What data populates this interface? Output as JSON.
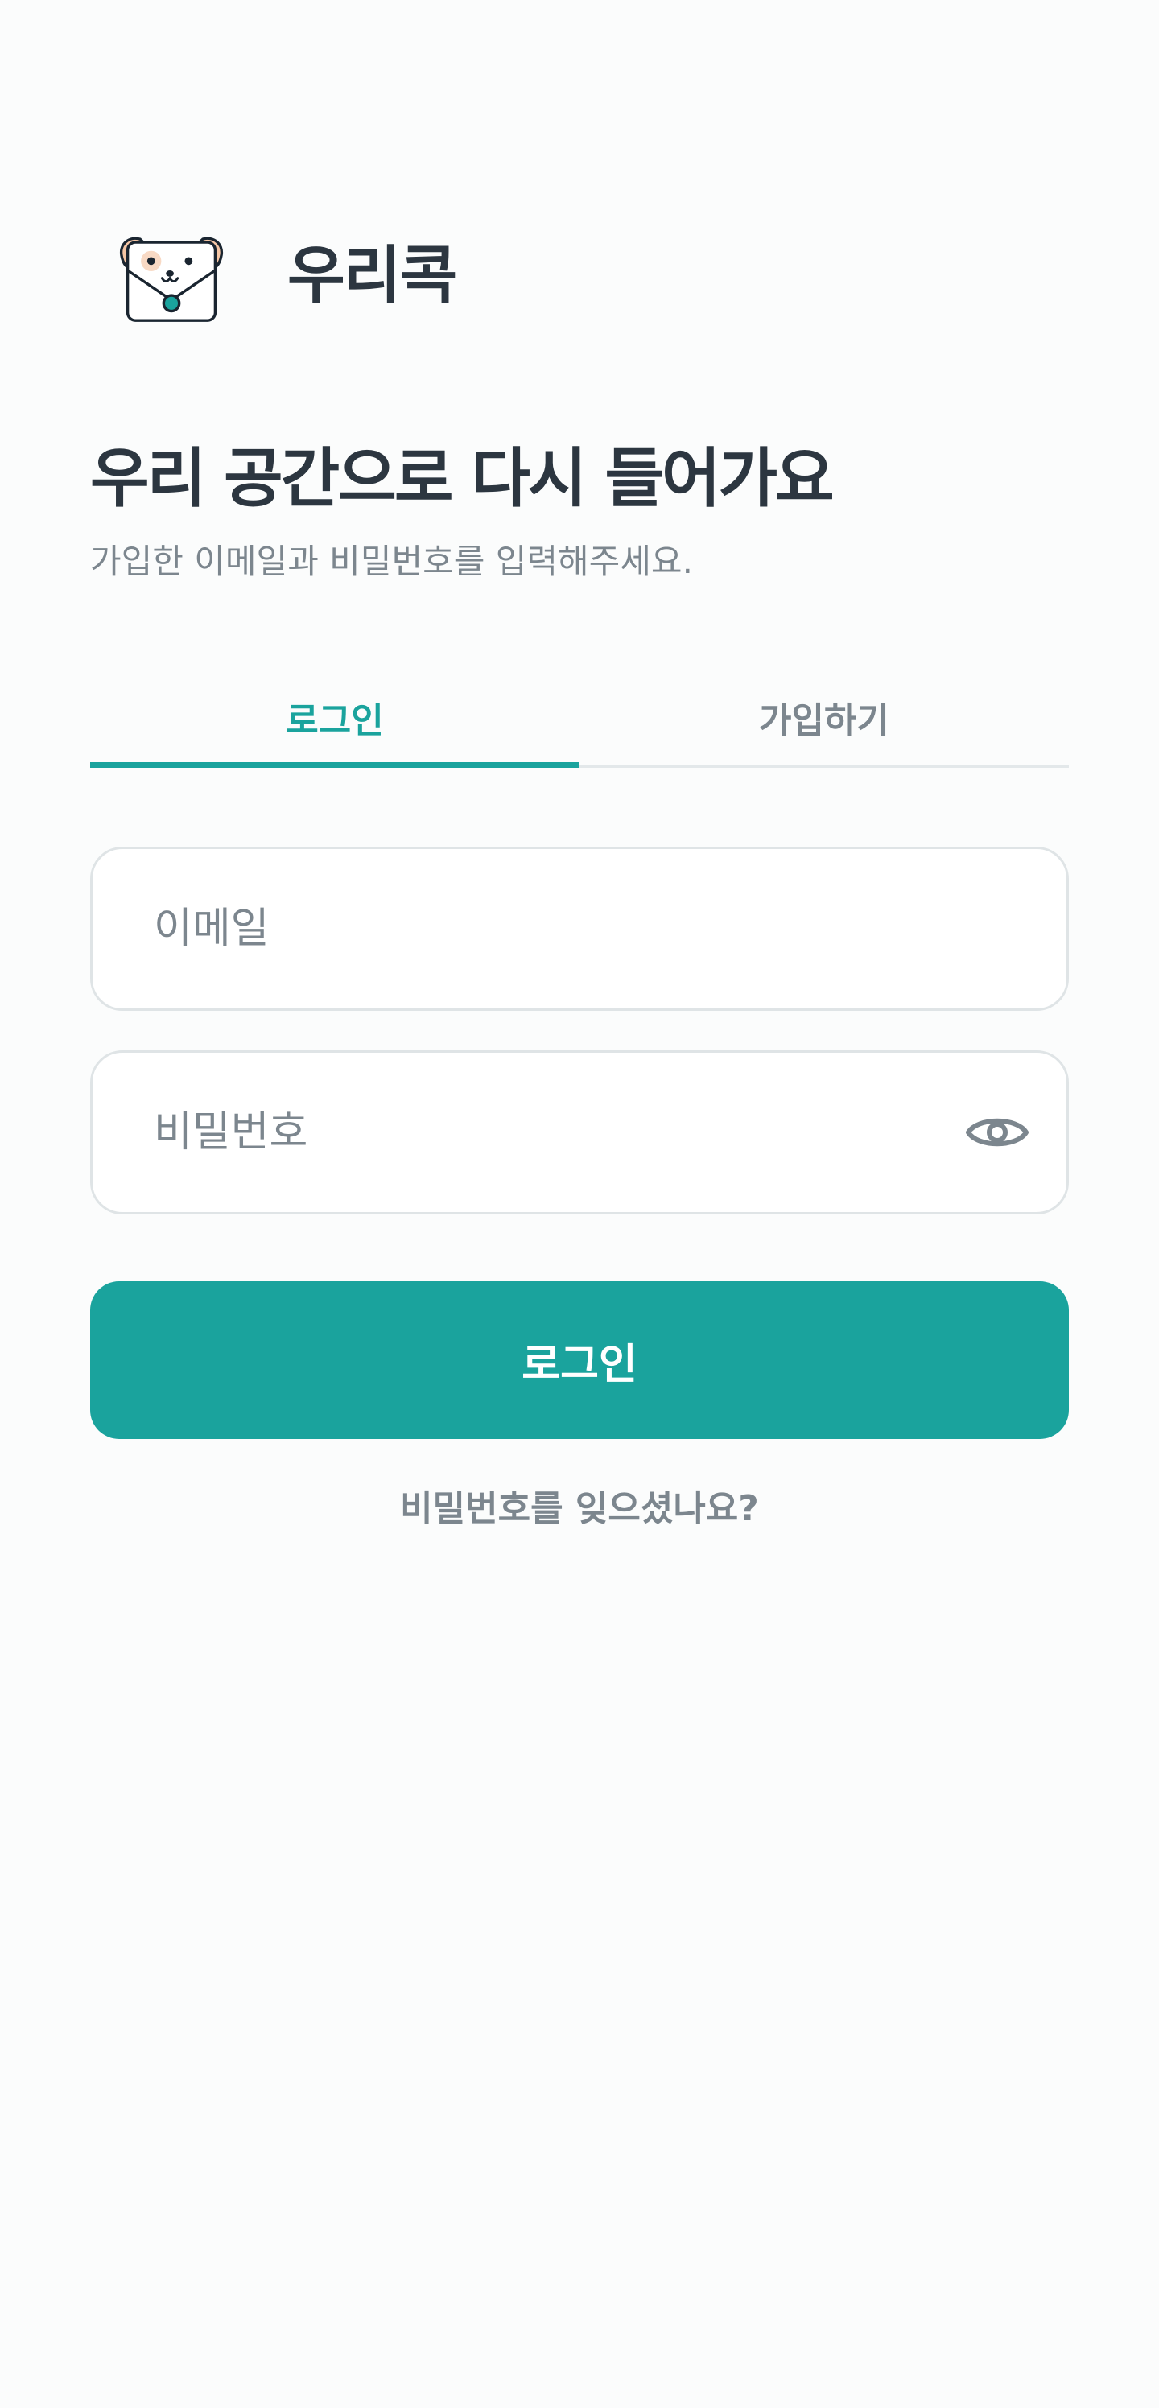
{
  "brand": {
    "name": "우리콕",
    "logo_icon": "puppy-envelope-icon"
  },
  "heading": "우리 공간으로 다시 들어가요",
  "subheading": "가입한 이메일과 비밀번호를 입력해주세요.",
  "tabs": [
    {
      "label": "로그인",
      "active": true
    },
    {
      "label": "가입하기",
      "active": false
    }
  ],
  "form": {
    "email": {
      "value": "",
      "placeholder": "이메일"
    },
    "password": {
      "value": "",
      "placeholder": "비밀번호",
      "toggle_icon": "eye-icon"
    },
    "submit_label": "로그인",
    "forgot_label": "비밀번호를 잊으셨나요?"
  },
  "colors": {
    "accent": "#1aa39d",
    "text_primary": "#2c3640",
    "text_secondary": "#7c868e",
    "background": "#fbfcfc",
    "border": "#dfe4e6"
  }
}
